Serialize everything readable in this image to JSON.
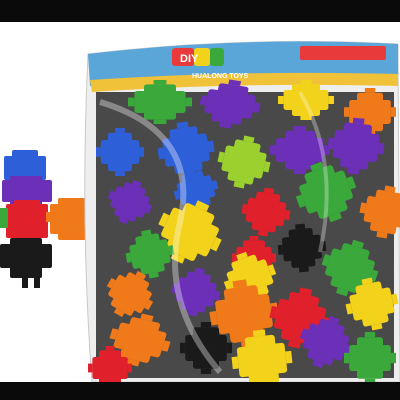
{
  "image": {
    "subject": "toy-building-blocks-product-photo",
    "background_color": "#ffffff",
    "frame_color": "#0a0a0a"
  },
  "bag": {
    "brand_logo_text": "DIY",
    "brand_subtitle": "HUALONG TOYS",
    "header_color": "#5aa6d8",
    "label_color": "#e83a3a"
  },
  "block_colors": {
    "red": "#e0202a",
    "blue": "#2d5fd8",
    "purple": "#6b2fb8",
    "green": "#3aa83a",
    "yellow": "#f2d21a",
    "orange": "#f07a1a",
    "black": "#1a1a1a",
    "lime": "#9ad12e"
  }
}
